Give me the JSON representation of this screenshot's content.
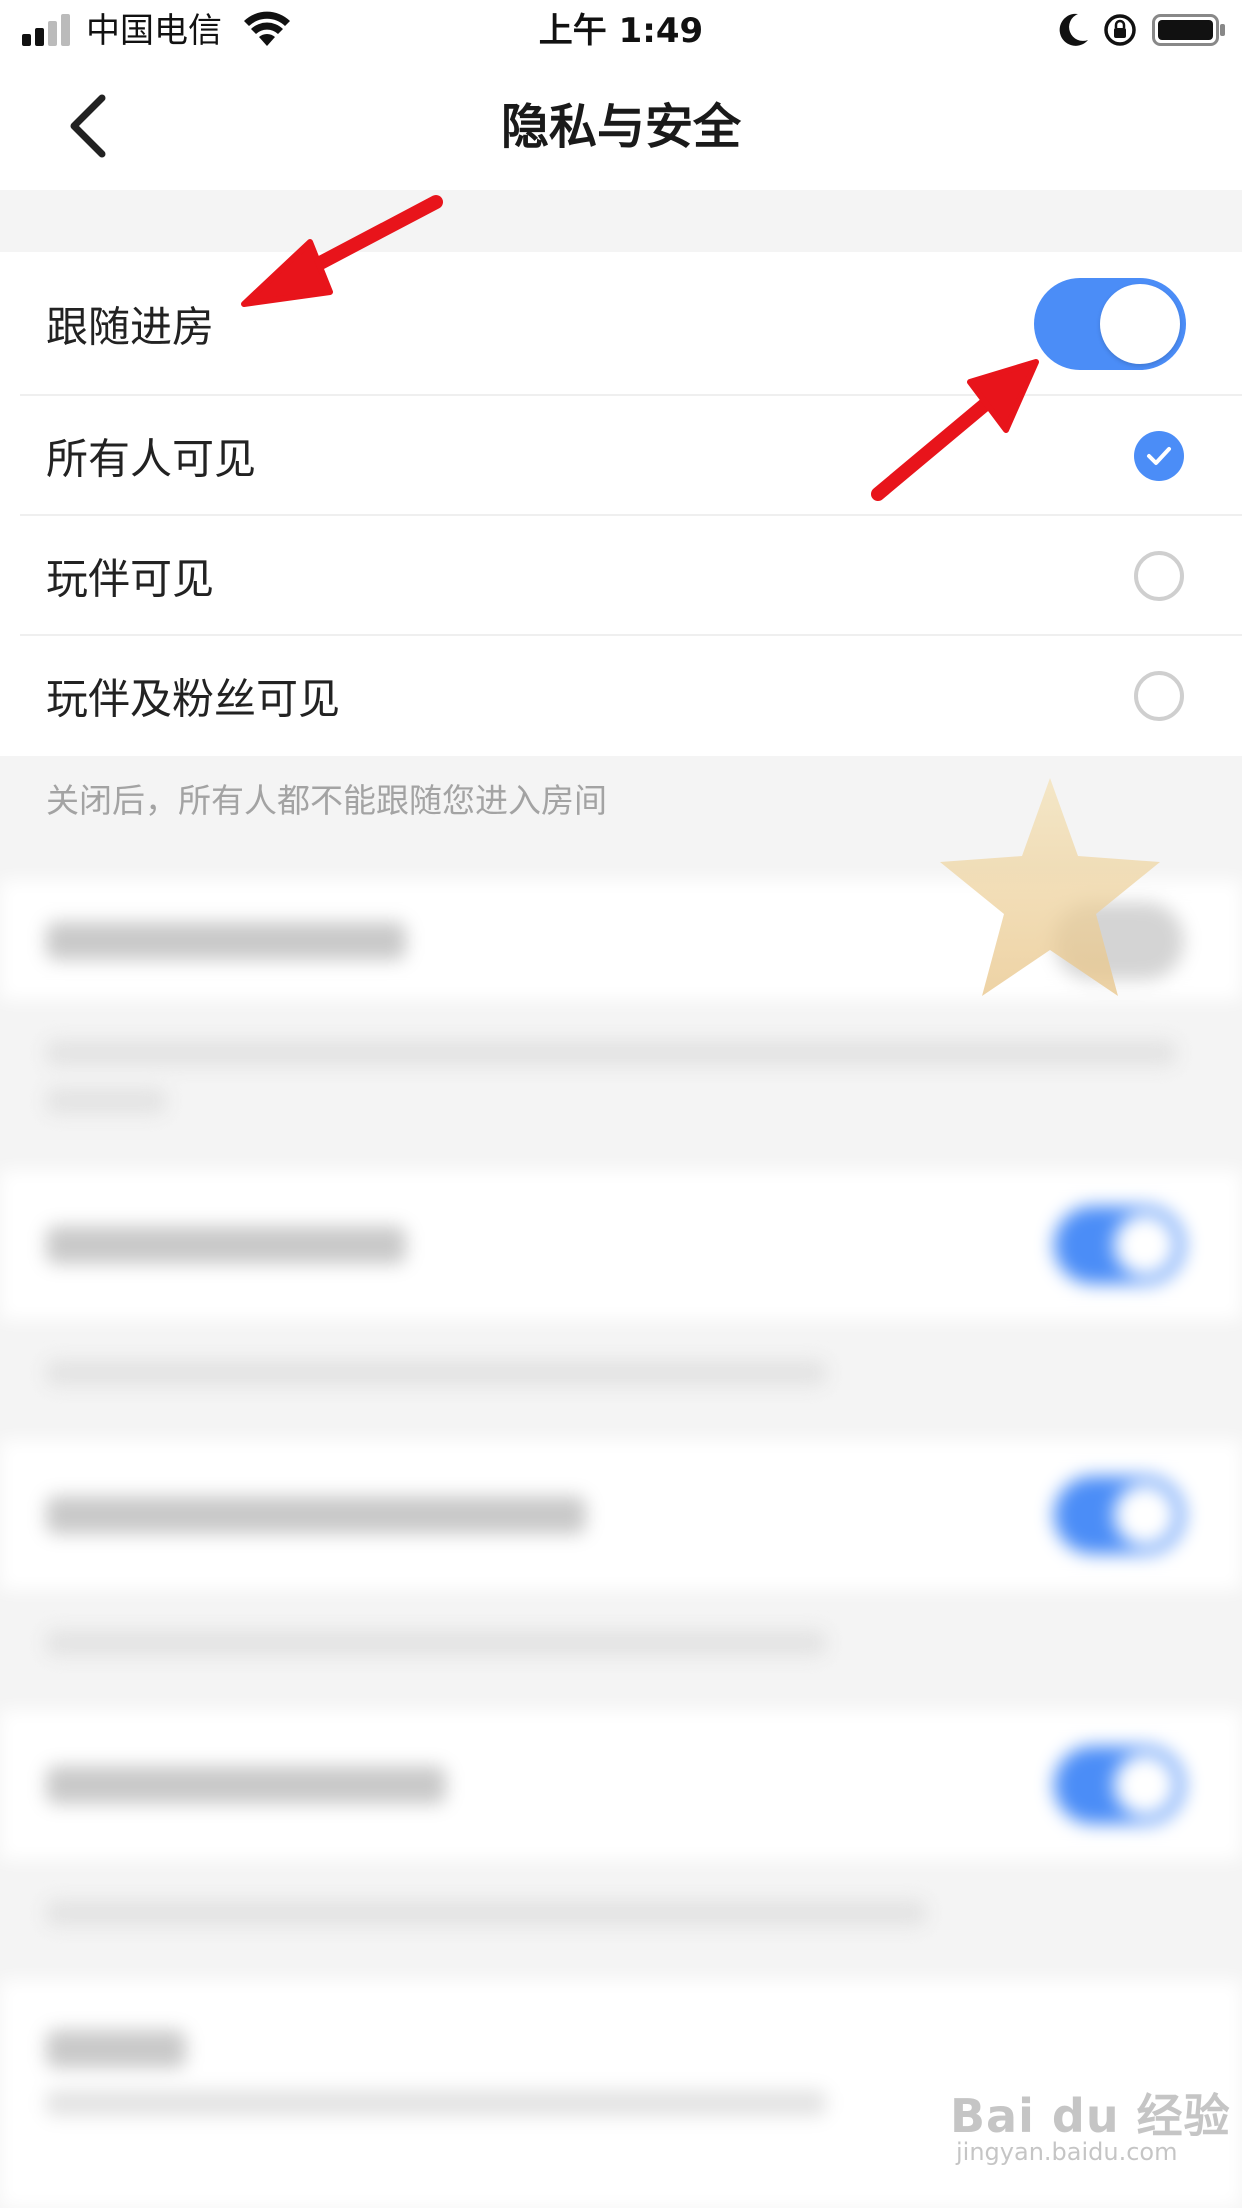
{
  "status_bar": {
    "carrier": "中国电信",
    "time": "上午 1:49"
  },
  "nav": {
    "title": "隐私与安全"
  },
  "follow_setting": {
    "label": "跟随进房",
    "enabled": true,
    "options": [
      {
        "label": "所有人可见",
        "selected": true
      },
      {
        "label": "玩伴可见",
        "selected": false
      },
      {
        "label": "玩伴及粉丝可见",
        "selected": false
      }
    ],
    "hint": "关闭后，所有人都不能跟随您进入房间"
  },
  "watermark": {
    "logo": "Bai du 经验",
    "url": "jingyan.baidu.com"
  },
  "colors": {
    "accent": "#4b8df7",
    "annotation_arrow": "#e8141b",
    "page_bg": "#f4f4f4"
  },
  "icons": [
    "signal-icon",
    "wifi-icon",
    "moon-icon",
    "rotation-lock-icon",
    "battery-icon",
    "back-chevron-icon",
    "check-icon",
    "star-badge-icon",
    "annotation-arrow-icon"
  ]
}
